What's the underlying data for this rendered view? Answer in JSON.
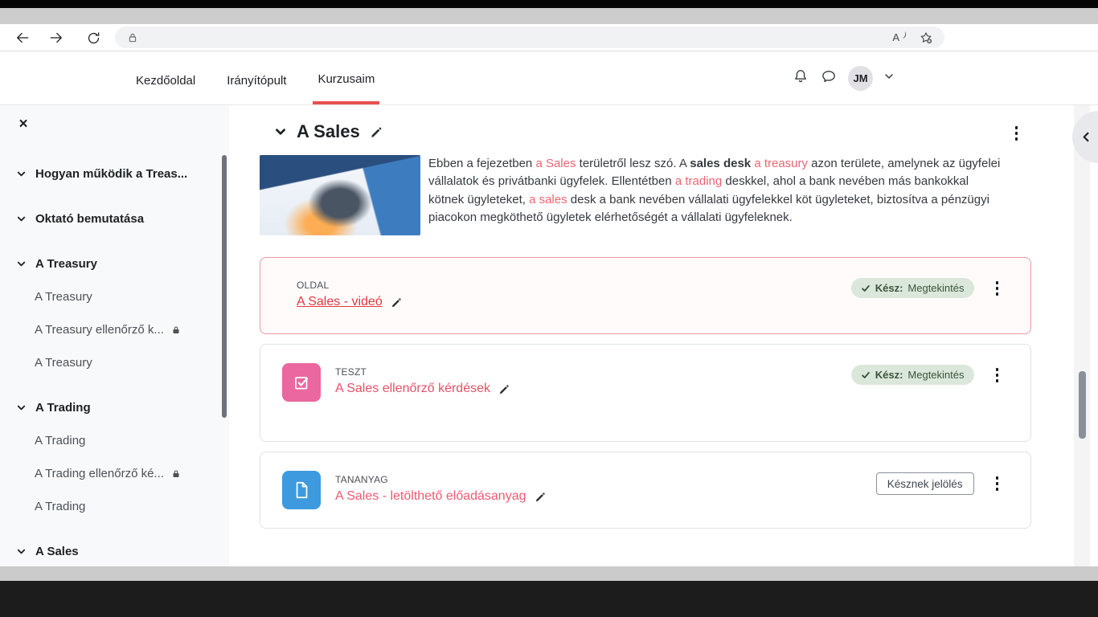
{
  "colors": {
    "brand": "#e8514e",
    "accent-text": "#ed6572",
    "link1": "#dc3b3f",
    "link2": "#e65168",
    "link3": "#ee5a72",
    "icon-blue": "#3d9adf",
    "icon-pink": "#ea679f",
    "badge-bg": "#dce7db",
    "badge-text": "#39543d"
  },
  "browser": {
    "address_value": "",
    "icons": [
      "back-arrow",
      "forward-arrow",
      "refresh",
      "lock",
      "read-aloud",
      "add-favorite"
    ],
    "read_aloud_letter": "A"
  },
  "header": {
    "nav": [
      {
        "label": "Kezdőoldal",
        "active": false
      },
      {
        "label": "Irányítópult",
        "active": false
      },
      {
        "label": "Kurzusaim",
        "active": true
      }
    ],
    "user_initials": "JM",
    "icons": [
      "notifications-bell",
      "messages-bubble",
      "user-menu-chevron"
    ]
  },
  "sidebar": {
    "close_glyph": "×",
    "items": [
      {
        "label": "Hogyan működik a Treas...",
        "type": "section"
      },
      {
        "label": "Oktató bemutatása",
        "type": "section"
      },
      {
        "label": "A Treasury",
        "type": "section"
      },
      {
        "label": "A Treasury",
        "type": "item",
        "locked": false
      },
      {
        "label": "A Treasury ellenőrző k...",
        "type": "item",
        "locked": true
      },
      {
        "label": "A Treasury",
        "type": "item",
        "locked": false
      },
      {
        "label": "A Trading",
        "type": "section"
      },
      {
        "label": "A Trading",
        "type": "item",
        "locked": false
      },
      {
        "label": "A Trading ellenőrző ké...",
        "type": "item",
        "locked": true
      },
      {
        "label": "A Trading",
        "type": "item",
        "locked": false
      },
      {
        "label": "A Sales",
        "type": "section"
      }
    ]
  },
  "content": {
    "section": {
      "title": "A Sales"
    },
    "intro": {
      "segments": [
        {
          "text": "Ebben a fejezetben ",
          "style": "normal"
        },
        {
          "text": "a Sales",
          "style": "accent"
        },
        {
          "text": " területről lesz szó. A ",
          "style": "normal"
        },
        {
          "text": "sales desk",
          "style": "bold"
        },
        {
          "text": " ",
          "style": "normal"
        },
        {
          "text": "a treasury",
          "style": "accent"
        },
        {
          "text": " azon területe, amelynek az ügyfelei vállalatok és privátbanki ügyfelek. Ellentétben ",
          "style": "normal"
        },
        {
          "text": "a trading",
          "style": "accent"
        },
        {
          "text": " deskkel, ahol a bank nevében más bankokkal kötnek ügyleteket, ",
          "style": "normal"
        },
        {
          "text": "a sales",
          "style": "accent"
        },
        {
          "text": " desk a bank nevében vállalati ügyfelekkel köt ügyleteket, biztosítva a pénzügyi piacokon megköthető ügyletek elérhetőségét a vállalati ügyfeleknek.",
          "style": "normal"
        }
      ]
    },
    "cards": [
      {
        "type_label": "OLDAL",
        "title": "A Sales - videó",
        "icon": "page",
        "completion": {
          "kind": "done",
          "state_bold": "Kész:",
          "state_text": "Megtekintés"
        }
      },
      {
        "type_label": "TESZT",
        "title": "A Sales ellenőrző kérdések",
        "icon": "quiz",
        "completion": {
          "kind": "done",
          "state_bold": "Kész:",
          "state_text": "Megtekintés"
        }
      },
      {
        "type_label": "TANANYAG",
        "title": "A Sales - letölthető előadásanyag",
        "icon": "resource",
        "completion": {
          "kind": "button",
          "button_label": "Késznek jelölés"
        }
      }
    ]
  }
}
